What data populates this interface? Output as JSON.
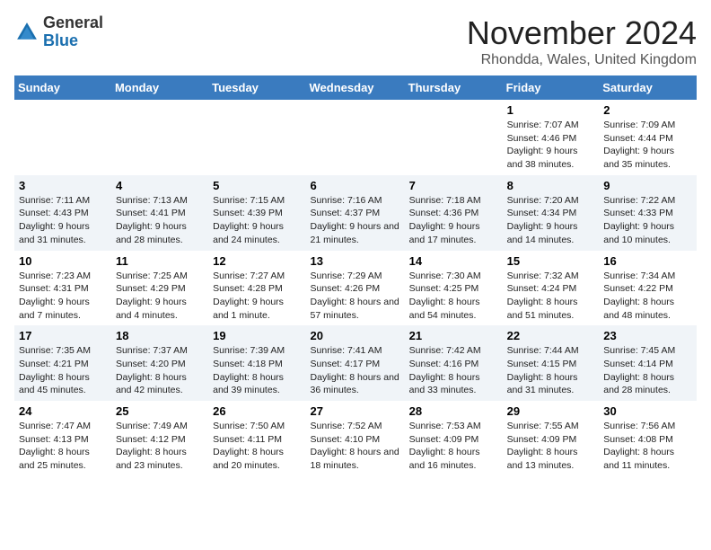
{
  "logo": {
    "text_general": "General",
    "text_blue": "Blue"
  },
  "header": {
    "month": "November 2024",
    "location": "Rhondda, Wales, United Kingdom"
  },
  "weekdays": [
    "Sunday",
    "Monday",
    "Tuesday",
    "Wednesday",
    "Thursday",
    "Friday",
    "Saturday"
  ],
  "weeks": [
    [
      {
        "day": "",
        "sunrise": "",
        "sunset": "",
        "daylight": ""
      },
      {
        "day": "",
        "sunrise": "",
        "sunset": "",
        "daylight": ""
      },
      {
        "day": "",
        "sunrise": "",
        "sunset": "",
        "daylight": ""
      },
      {
        "day": "",
        "sunrise": "",
        "sunset": "",
        "daylight": ""
      },
      {
        "day": "",
        "sunrise": "",
        "sunset": "",
        "daylight": ""
      },
      {
        "day": "1",
        "sunrise": "Sunrise: 7:07 AM",
        "sunset": "Sunset: 4:46 PM",
        "daylight": "Daylight: 9 hours and 38 minutes."
      },
      {
        "day": "2",
        "sunrise": "Sunrise: 7:09 AM",
        "sunset": "Sunset: 4:44 PM",
        "daylight": "Daylight: 9 hours and 35 minutes."
      }
    ],
    [
      {
        "day": "3",
        "sunrise": "Sunrise: 7:11 AM",
        "sunset": "Sunset: 4:43 PM",
        "daylight": "Daylight: 9 hours and 31 minutes."
      },
      {
        "day": "4",
        "sunrise": "Sunrise: 7:13 AM",
        "sunset": "Sunset: 4:41 PM",
        "daylight": "Daylight: 9 hours and 28 minutes."
      },
      {
        "day": "5",
        "sunrise": "Sunrise: 7:15 AM",
        "sunset": "Sunset: 4:39 PM",
        "daylight": "Daylight: 9 hours and 24 minutes."
      },
      {
        "day": "6",
        "sunrise": "Sunrise: 7:16 AM",
        "sunset": "Sunset: 4:37 PM",
        "daylight": "Daylight: 9 hours and 21 minutes."
      },
      {
        "day": "7",
        "sunrise": "Sunrise: 7:18 AM",
        "sunset": "Sunset: 4:36 PM",
        "daylight": "Daylight: 9 hours and 17 minutes."
      },
      {
        "day": "8",
        "sunrise": "Sunrise: 7:20 AM",
        "sunset": "Sunset: 4:34 PM",
        "daylight": "Daylight: 9 hours and 14 minutes."
      },
      {
        "day": "9",
        "sunrise": "Sunrise: 7:22 AM",
        "sunset": "Sunset: 4:33 PM",
        "daylight": "Daylight: 9 hours and 10 minutes."
      }
    ],
    [
      {
        "day": "10",
        "sunrise": "Sunrise: 7:23 AM",
        "sunset": "Sunset: 4:31 PM",
        "daylight": "Daylight: 9 hours and 7 minutes."
      },
      {
        "day": "11",
        "sunrise": "Sunrise: 7:25 AM",
        "sunset": "Sunset: 4:29 PM",
        "daylight": "Daylight: 9 hours and 4 minutes."
      },
      {
        "day": "12",
        "sunrise": "Sunrise: 7:27 AM",
        "sunset": "Sunset: 4:28 PM",
        "daylight": "Daylight: 9 hours and 1 minute."
      },
      {
        "day": "13",
        "sunrise": "Sunrise: 7:29 AM",
        "sunset": "Sunset: 4:26 PM",
        "daylight": "Daylight: 8 hours and 57 minutes."
      },
      {
        "day": "14",
        "sunrise": "Sunrise: 7:30 AM",
        "sunset": "Sunset: 4:25 PM",
        "daylight": "Daylight: 8 hours and 54 minutes."
      },
      {
        "day": "15",
        "sunrise": "Sunrise: 7:32 AM",
        "sunset": "Sunset: 4:24 PM",
        "daylight": "Daylight: 8 hours and 51 minutes."
      },
      {
        "day": "16",
        "sunrise": "Sunrise: 7:34 AM",
        "sunset": "Sunset: 4:22 PM",
        "daylight": "Daylight: 8 hours and 48 minutes."
      }
    ],
    [
      {
        "day": "17",
        "sunrise": "Sunrise: 7:35 AM",
        "sunset": "Sunset: 4:21 PM",
        "daylight": "Daylight: 8 hours and 45 minutes."
      },
      {
        "day": "18",
        "sunrise": "Sunrise: 7:37 AM",
        "sunset": "Sunset: 4:20 PM",
        "daylight": "Daylight: 8 hours and 42 minutes."
      },
      {
        "day": "19",
        "sunrise": "Sunrise: 7:39 AM",
        "sunset": "Sunset: 4:18 PM",
        "daylight": "Daylight: 8 hours and 39 minutes."
      },
      {
        "day": "20",
        "sunrise": "Sunrise: 7:41 AM",
        "sunset": "Sunset: 4:17 PM",
        "daylight": "Daylight: 8 hours and 36 minutes."
      },
      {
        "day": "21",
        "sunrise": "Sunrise: 7:42 AM",
        "sunset": "Sunset: 4:16 PM",
        "daylight": "Daylight: 8 hours and 33 minutes."
      },
      {
        "day": "22",
        "sunrise": "Sunrise: 7:44 AM",
        "sunset": "Sunset: 4:15 PM",
        "daylight": "Daylight: 8 hours and 31 minutes."
      },
      {
        "day": "23",
        "sunrise": "Sunrise: 7:45 AM",
        "sunset": "Sunset: 4:14 PM",
        "daylight": "Daylight: 8 hours and 28 minutes."
      }
    ],
    [
      {
        "day": "24",
        "sunrise": "Sunrise: 7:47 AM",
        "sunset": "Sunset: 4:13 PM",
        "daylight": "Daylight: 8 hours and 25 minutes."
      },
      {
        "day": "25",
        "sunrise": "Sunrise: 7:49 AM",
        "sunset": "Sunset: 4:12 PM",
        "daylight": "Daylight: 8 hours and 23 minutes."
      },
      {
        "day": "26",
        "sunrise": "Sunrise: 7:50 AM",
        "sunset": "Sunset: 4:11 PM",
        "daylight": "Daylight: 8 hours and 20 minutes."
      },
      {
        "day": "27",
        "sunrise": "Sunrise: 7:52 AM",
        "sunset": "Sunset: 4:10 PM",
        "daylight": "Daylight: 8 hours and 18 minutes."
      },
      {
        "day": "28",
        "sunrise": "Sunrise: 7:53 AM",
        "sunset": "Sunset: 4:09 PM",
        "daylight": "Daylight: 8 hours and 16 minutes."
      },
      {
        "day": "29",
        "sunrise": "Sunrise: 7:55 AM",
        "sunset": "Sunset: 4:09 PM",
        "daylight": "Daylight: 8 hours and 13 minutes."
      },
      {
        "day": "30",
        "sunrise": "Sunrise: 7:56 AM",
        "sunset": "Sunset: 4:08 PM",
        "daylight": "Daylight: 8 hours and 11 minutes."
      }
    ]
  ]
}
